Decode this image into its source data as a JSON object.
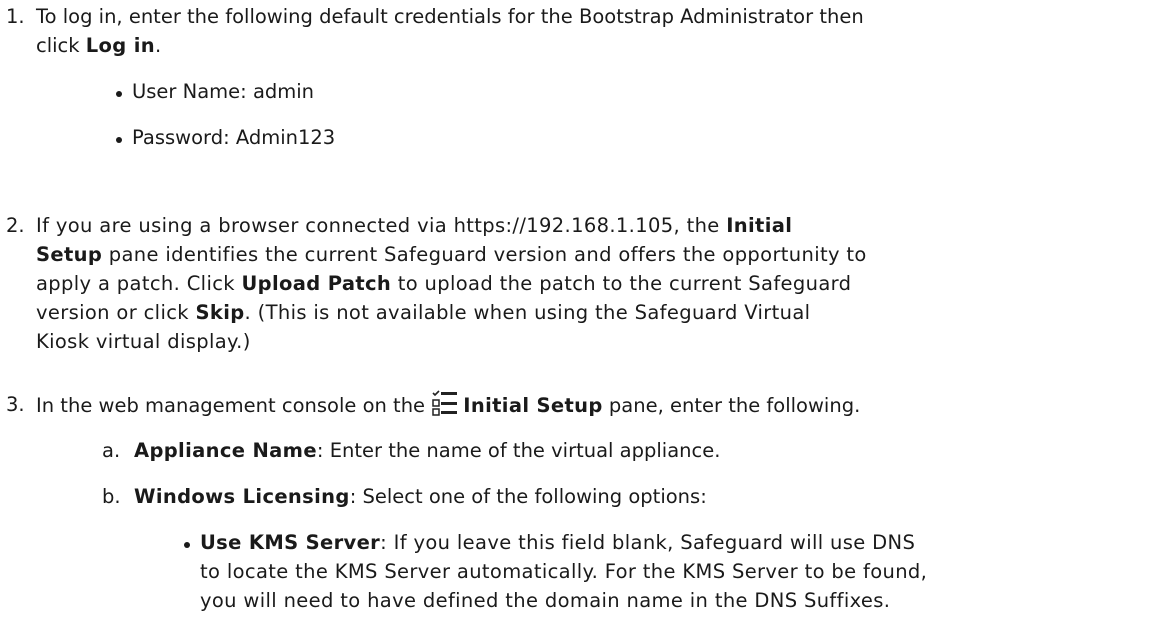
{
  "step1": {
    "num": "1.",
    "text_a": "To log in, enter the following default credentials for the Bootstrap Administrator then",
    "text_b": "click ",
    "bold": "Log in",
    "end": ".",
    "bullets": [
      "User Name: admin",
      "Password: Admin123"
    ]
  },
  "step2": {
    "num": "2.",
    "line1_a": "If you are using a browser connected via https://192.168.1.105, the ",
    "line1_bold": "Initial",
    "line2_bold": "Setup",
    "line2_a": " pane identifies the current Safeguard version and offers the opportunity to",
    "line3": "apply a patch. Click ",
    "line3_bold": "Upload Patch",
    "line3_b": " to upload the patch to the current Safeguard",
    "line4_a": "version or click ",
    "line4_bold": "Skip",
    "line4_b": ". (This is not available when using the Safeguard Virtual",
    "line5": "Kiosk virtual display.)"
  },
  "step3": {
    "num": "3.",
    "text_a": "In the web management console on the ",
    "icon": "checklist-icon",
    "bold": "Initial Setup",
    "text_b": " pane, enter the following.",
    "sub_a": {
      "letter": "a.",
      "bold": "Appliance Name",
      "text": ": Enter the name of the virtual appliance."
    },
    "sub_b": {
      "letter": "b.",
      "bold": "Windows Licensing",
      "text": ": Select one of the following options:",
      "bullet": {
        "bold": "Use KMS Server",
        "line1": ": If you leave this field blank, Safeguard will use DNS",
        "line2": "to locate the KMS Server automatically. For the KMS Server to be found,",
        "line3": "you will need to have defined the domain name in the DNS Suffixes."
      }
    }
  }
}
